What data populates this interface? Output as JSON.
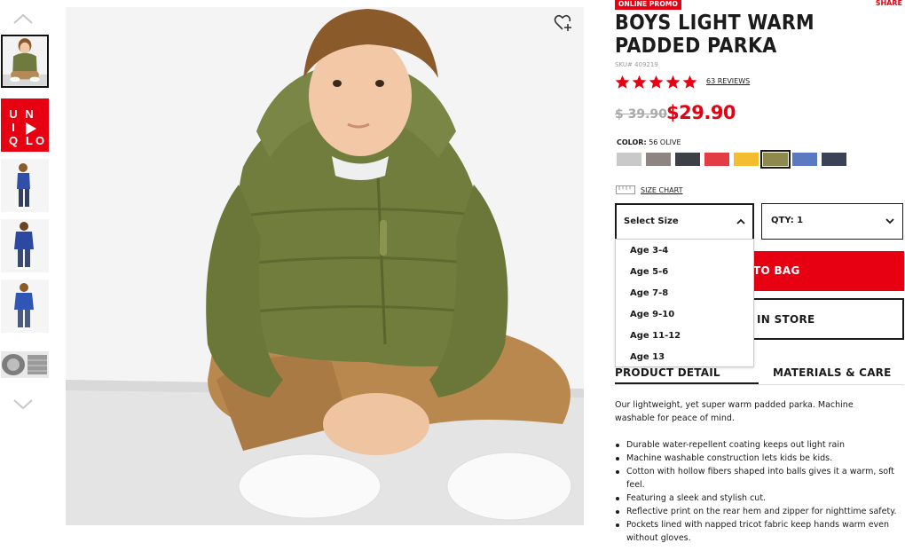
{
  "thumbnails": [
    {
      "name": "thumb-boy-olive"
    },
    {
      "name": "thumb-uniqlo-video",
      "logo_text": "UNIQLO"
    },
    {
      "name": "thumb-boy-blue-side"
    },
    {
      "name": "thumb-boy-blue-back"
    },
    {
      "name": "thumb-boy-blue-front"
    },
    {
      "name": "thumb-jacket-detail"
    }
  ],
  "product": {
    "promo_label": "ONLINE PROMO",
    "share_label": "SHARE",
    "title": "BOYS LIGHT WARM PADDED PARKA",
    "sku": "SKU# 409219",
    "rating": 5,
    "reviews": "63 REVIEWS",
    "original_price": "$ 39.90",
    "sale_price": "$29.90"
  },
  "color": {
    "label": "COLOR:",
    "value": "56 OLIVE",
    "swatches": [
      {
        "name": "light-gray",
        "hex": "#c9c9c9",
        "selected": false
      },
      {
        "name": "gray",
        "hex": "#8e8582",
        "selected": false
      },
      {
        "name": "charcoal",
        "hex": "#3d4047",
        "selected": false
      },
      {
        "name": "red",
        "hex": "#e23c45",
        "selected": false
      },
      {
        "name": "yellow",
        "hex": "#f2bd2f",
        "selected": false
      },
      {
        "name": "olive",
        "hex": "#8e8a4e",
        "selected": true
      },
      {
        "name": "blue",
        "hex": "#5b79c3",
        "selected": false
      },
      {
        "name": "navy",
        "hex": "#3b4157",
        "selected": false
      }
    ]
  },
  "size_chart_label": "SIZE CHART",
  "size_select": {
    "value": "Select Size",
    "options": [
      "Age 3-4",
      "Age 5-6",
      "Age 7-8",
      "Age 9-10",
      "Age 11-12",
      "Age 13"
    ]
  },
  "qty": {
    "value": "QTY: 1"
  },
  "buttons": {
    "add_to_bag": "TO BAG",
    "find_in_store": "IN STORE"
  },
  "tabs": [
    "PRODUCT DETAIL",
    "MATERIALS & CARE"
  ],
  "description": "Our lightweight, yet super warm padded parka. Machine washable for peace of mind.",
  "features": [
    "Durable water-repellent coating keeps out light rain",
    "Machine washable construction lets kids be kids.",
    "Cotton with hollow fibers shaped into balls gives it a warm, soft feel.",
    "Featuring a sleek and stylish cut.",
    "Reflective print on the rear hem and zipper for nighttime safety.",
    "Pockets lined with napped tricot fabric keep hands warm even without gloves."
  ],
  "colors": {
    "accent": "#e60012",
    "text": "#1b1b1b"
  }
}
